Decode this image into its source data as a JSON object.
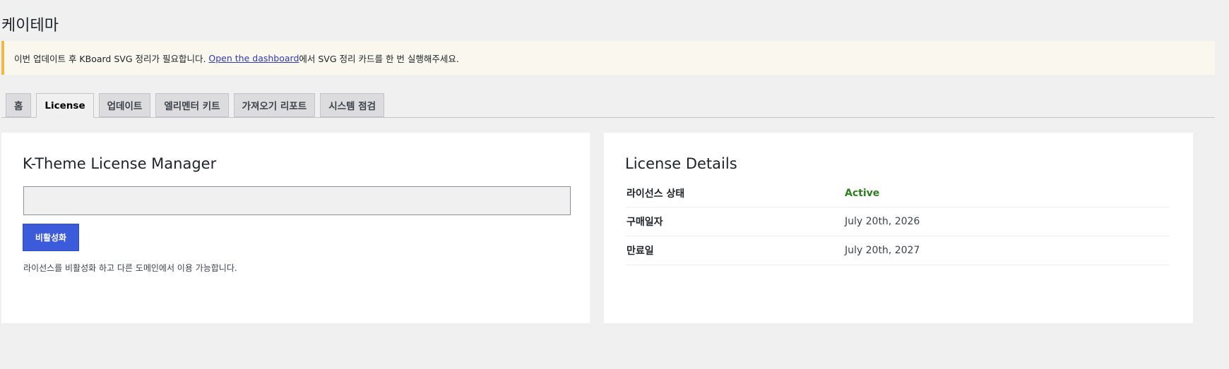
{
  "page": {
    "title": "케이테마"
  },
  "notice": {
    "text_before": "이번 업데이트 후 KBoard SVG 정리가 필요합니다. ",
    "link_text": "Open the dashboard",
    "text_after": "에서 SVG 정리 카드를 한 번 실행해주세요.",
    "accent_color": "#f0b849"
  },
  "tabs": [
    {
      "label": "홈",
      "active": false
    },
    {
      "label": "License",
      "active": true
    },
    {
      "label": "업데이트",
      "active": false
    },
    {
      "label": "엘리멘터 키트",
      "active": false
    },
    {
      "label": "가져오기 리포트",
      "active": false
    },
    {
      "label": "시스템 점검",
      "active": false
    }
  ],
  "license_manager": {
    "title": "K-Theme License Manager",
    "input_value": "",
    "deactivate_label": "비활성화",
    "button_color": "#3b5bdb",
    "help_text": "라이선스를 비활성화 하고 다른 도메인에서 이용 가능합니다."
  },
  "license_details": {
    "title": "License Details",
    "rows": [
      {
        "label": "라이선스 상태",
        "value": "Active",
        "status_color": "#2e7d1f"
      },
      {
        "label": "구매일자",
        "value": "July 20th, 2026"
      },
      {
        "label": "만료일",
        "value": "July 20th, 2027"
      }
    ]
  }
}
